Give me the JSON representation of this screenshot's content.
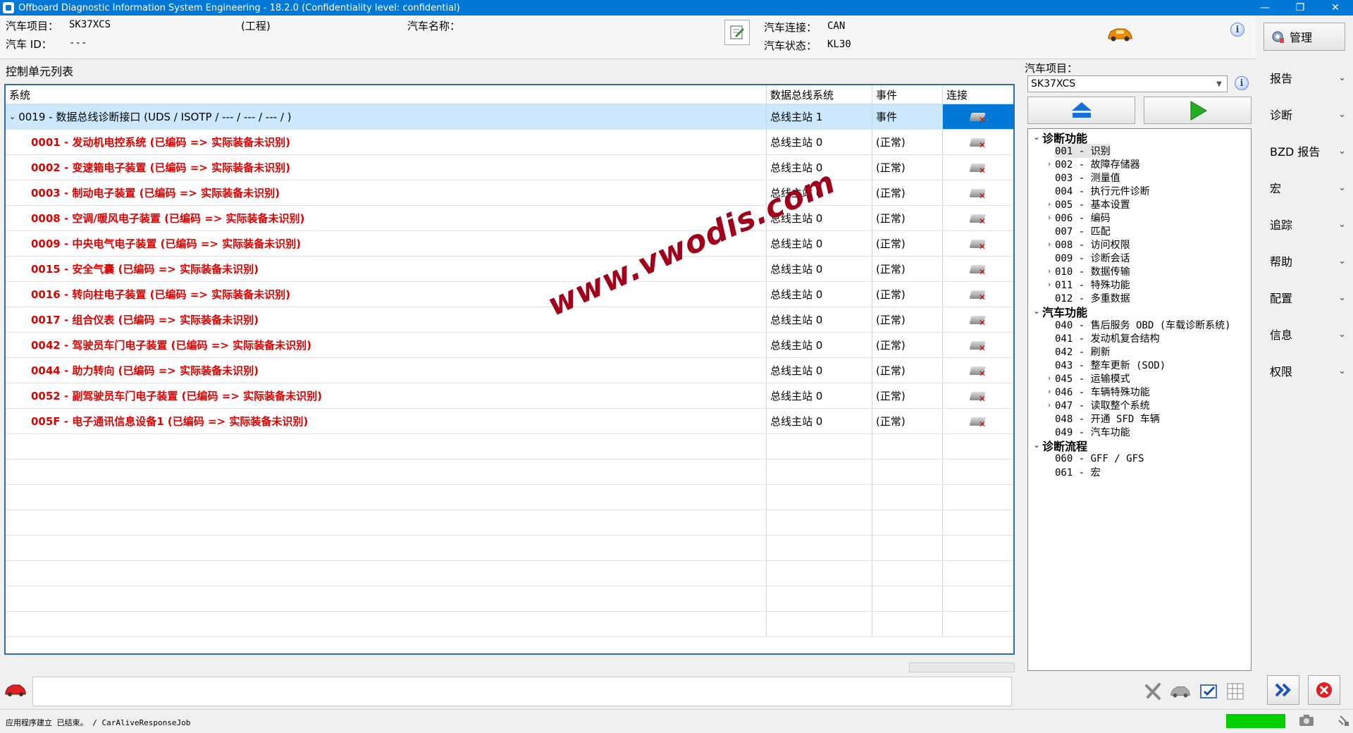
{
  "window": {
    "title": "Offboard Diagnostic Information System Engineering - 18.2.0 (Confidentiality level: confidential)",
    "minimize": "—",
    "maximize": "❐",
    "close": "✕"
  },
  "header": {
    "project_label": "汽车项目：",
    "project_value": "SK37XCS",
    "project_type": "(工程)",
    "vehicle_name_label": "汽车名称：",
    "vehicle_id_label": "汽车 ID：",
    "vehicle_id_value": "---",
    "connection_label": "汽车连接：",
    "connection_value": "CAN",
    "state_label": "汽车状态：",
    "state_value": "KL30"
  },
  "manage_button": {
    "label": "管理"
  },
  "right_menu": [
    {
      "label": "报告"
    },
    {
      "label": "诊断"
    },
    {
      "label": "BZD 报告"
    },
    {
      "label": "宏"
    },
    {
      "label": "追踪"
    },
    {
      "label": "帮助"
    },
    {
      "label": "配置"
    },
    {
      "label": "信息"
    },
    {
      "label": "权限"
    }
  ],
  "control_units": {
    "title": "控制单元列表",
    "columns": [
      "系统",
      "数据总线系统",
      "事件",
      "连接"
    ],
    "gateway": {
      "system": "0019 - 数据总线诊断接口  (UDS / ISOTP / --- / --- / --- /  )",
      "bus": "总线主站 1",
      "event": "事件"
    },
    "rows": [
      {
        "system": "0001 - 发动机电控系统  (已编码 => 实际装备未识别)",
        "bus": "总线主站 0",
        "event": "(正常)"
      },
      {
        "system": "0002 - 变速箱电子装置  (已编码 => 实际装备未识别)",
        "bus": "总线主站 0",
        "event": "(正常)"
      },
      {
        "system": "0003 - 制动电子装置  (已编码 => 实际装备未识别)",
        "bus": "总线主站 0",
        "event": "(正常)"
      },
      {
        "system": "0008 - 空调/暖风电子装置  (已编码 => 实际装备未识别)",
        "bus": "总线主站 0",
        "event": "(正常)"
      },
      {
        "system": "0009 - 中央电气电子装置  (已编码 => 实际装备未识别)",
        "bus": "总线主站 0",
        "event": "(正常)"
      },
      {
        "system": "0015 - 安全气囊  (已编码 => 实际装备未识别)",
        "bus": "总线主站 0",
        "event": "(正常)"
      },
      {
        "system": "0016 - 转向柱电子装置  (已编码 => 实际装备未识别)",
        "bus": "总线主站 0",
        "event": "(正常)"
      },
      {
        "system": "0017 - 组合仪表  (已编码 => 实际装备未识别)",
        "bus": "总线主站 0",
        "event": "(正常)"
      },
      {
        "system": "0042 - 驾驶员车门电子装置  (已编码 => 实际装备未识别)",
        "bus": "总线主站 0",
        "event": "(正常)"
      },
      {
        "system": "0044 - 助力转向  (已编码 => 实际装备未识别)",
        "bus": "总线主站 0",
        "event": "(正常)"
      },
      {
        "system": "0052 - 副驾驶员车门电子装置  (已编码 => 实际装备未识别)",
        "bus": "总线主站 0",
        "event": "(正常)"
      },
      {
        "system": "005F - 电子通讯信息设备1  (已编码 => 实际装备未识别)",
        "bus": "总线主站 0",
        "event": "(正常)"
      }
    ]
  },
  "right_panel": {
    "label": "汽车项目：",
    "selected_project": "SK37XCS",
    "tree": [
      {
        "group": "诊断功能",
        "items": [
          {
            "label": "001 - 识别",
            "expandable": false,
            "selected": true
          },
          {
            "label": "002 - 故障存储器",
            "expandable": true
          },
          {
            "label": "003 - 测量值",
            "expandable": false
          },
          {
            "label": "004 - 执行元件诊断",
            "expandable": false
          },
          {
            "label": "005 - 基本设置",
            "expandable": true
          },
          {
            "label": "006 - 编码",
            "expandable": true
          },
          {
            "label": "007 - 匹配",
            "expandable": false
          },
          {
            "label": "008 - 访问权限",
            "expandable": true
          },
          {
            "label": "009 - 诊断会话",
            "expandable": false
          },
          {
            "label": "010 - 数据传输",
            "expandable": true
          },
          {
            "label": "011 - 特殊功能",
            "expandable": true
          },
          {
            "label": "012 - 多重数据",
            "expandable": false
          }
        ]
      },
      {
        "group": "汽车功能",
        "items": [
          {
            "label": "040 - 售后服务 OBD (车载诊断系统)",
            "expandable": false
          },
          {
            "label": "041 - 发动机复合结构",
            "expandable": false
          },
          {
            "label": "042 - 刷新",
            "expandable": false
          },
          {
            "label": "043 - 整车更新 (SOD)",
            "expandable": false
          },
          {
            "label": "045 - 运输模式",
            "expandable": true
          },
          {
            "label": "046 - 车辆特殊功能",
            "expandable": true
          },
          {
            "label": "047 - 读取整个系统",
            "expandable": true
          },
          {
            "label": "048 - 开通 SFD 车辆",
            "expandable": false
          },
          {
            "label": "049 - 汽车功能",
            "expandable": false
          }
        ]
      },
      {
        "group": "诊断流程",
        "items": [
          {
            "label": "060 - GFF / GFS",
            "expandable": false
          },
          {
            "label": "061 - 宏",
            "expandable": false
          }
        ]
      }
    ]
  },
  "statusbar": {
    "text": "应用程序建立 已结束。 / CarAliveResponseJob"
  },
  "watermark": "www.vwodis.com",
  "colors": {
    "titlebar": "#0078d7",
    "error_text": "#e00000",
    "selection": "#cce8ff",
    "progress": "#00d000"
  }
}
